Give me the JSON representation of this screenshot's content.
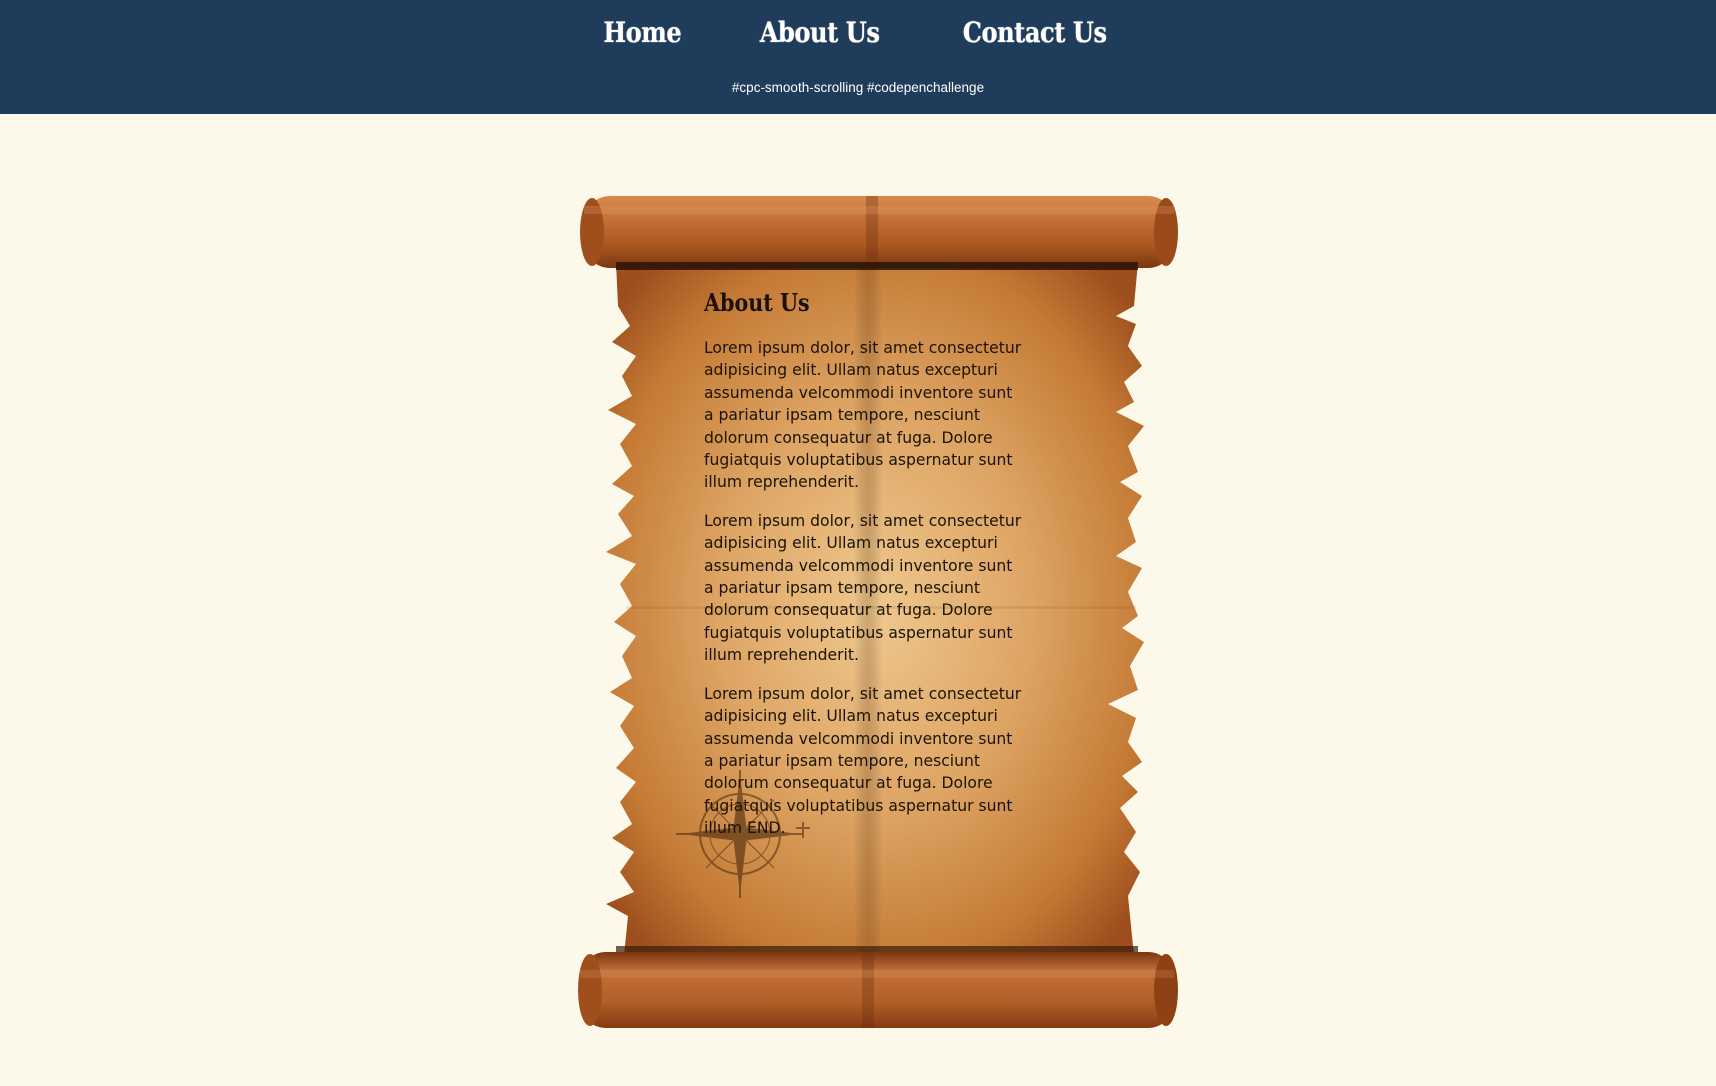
{
  "nav": {
    "items": [
      {
        "label": "Home"
      },
      {
        "label": "About Us"
      },
      {
        "label": "Contact Us"
      }
    ]
  },
  "tagline": "#cpc-smooth-scrolling #codepenchallenge",
  "scroll": {
    "title": "About Us",
    "paragraphs": [
      "Lorem ipsum dolor, sit amet consectetur adipisicing elit. Ullam natus excepturi assumenda velcommodi inventore sunt a pariatur ipsam tempore, nesciunt dolorum consequatur at fuga. Dolore fugiatquis voluptatibus aspernatur sunt illum reprehenderit.",
      "Lorem ipsum dolor, sit amet consectetur adipisicing elit. Ullam natus excepturi assumenda velcommodi inventore sunt a pariatur ipsam tempore, nesciunt dolorum consequatur at fuga. Dolore fugiatquis voluptatibus aspernatur sunt illum reprehenderit.",
      "Lorem ipsum dolor, sit amet consectetur adipisicing elit. Ullam natus excepturi assumenda velcommodi inventore sunt a pariatur ipsam tempore, nesciunt dolorum consequatur at fuga. Dolore fugiatquis voluptatibus aspernatur sunt illum END."
    ]
  },
  "colors": {
    "header_bg": "#1f3d5a",
    "page_bg": "#fdf9ea",
    "parchment": "#d9a05c",
    "roll": "#b8632b"
  },
  "icons": {
    "compass": "compass-rose-icon"
  }
}
